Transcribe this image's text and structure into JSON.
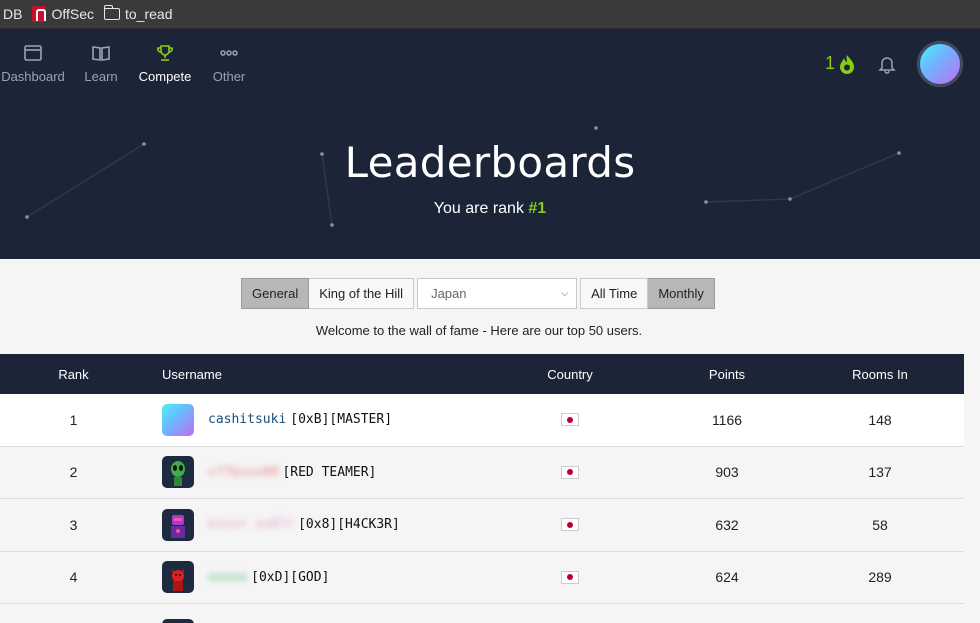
{
  "bookmarks": [
    {
      "label": "DB",
      "icon": "none"
    },
    {
      "label": "OffSec",
      "icon": "offsec-logo-icon"
    },
    {
      "label": "to_read",
      "icon": "folder-icon"
    }
  ],
  "nav": {
    "items": [
      {
        "label": "Dashboard",
        "icon": "window-icon",
        "active": false
      },
      {
        "label": "Learn",
        "icon": "book-icon",
        "active": false
      },
      {
        "label": "Compete",
        "icon": "trophy-icon",
        "active": true
      },
      {
        "label": "Other",
        "icon": "dots-icon",
        "active": false
      }
    ],
    "streak": "1",
    "accent": "#88cc14"
  },
  "hero": {
    "title": "Leaderboards",
    "subtitle_prefix": "You are rank ",
    "rank": "#1"
  },
  "filters": {
    "type_tabs": [
      "General",
      "King of the Hill"
    ],
    "type_active": "General",
    "country": "Japan",
    "period_tabs": [
      "All Time",
      "Monthly"
    ],
    "period_active": "Monthly"
  },
  "welcome": "Welcome to the wall of fame - Here are our top 50 users.",
  "table": {
    "headers": {
      "rank": "Rank",
      "username": "Username",
      "country": "Country",
      "points": "Points",
      "rooms": "Rooms In"
    },
    "rows": [
      {
        "rank": "1",
        "name": "cashitsuki",
        "tag": "[0xB][MASTER]",
        "points": "1166",
        "rooms": "148",
        "name_color": "#1b4e7a"
      },
      {
        "rank": "2",
        "name": "cf7bxxx00",
        "tag": "[RED TEAMER]",
        "points": "903",
        "rooms": "137",
        "name_color": "#e88a8a"
      },
      {
        "rank": "3",
        "name": "kxxxr xx07r",
        "tag": "[0x8][H4CK3R]",
        "points": "632",
        "rooms": "58",
        "name_color": "#e8a0c8"
      },
      {
        "rank": "4",
        "name": "xxxxx",
        "tag": "[0xD][GOD]",
        "points": "624",
        "rooms": "289",
        "name_color": "#4fbf70"
      }
    ]
  }
}
